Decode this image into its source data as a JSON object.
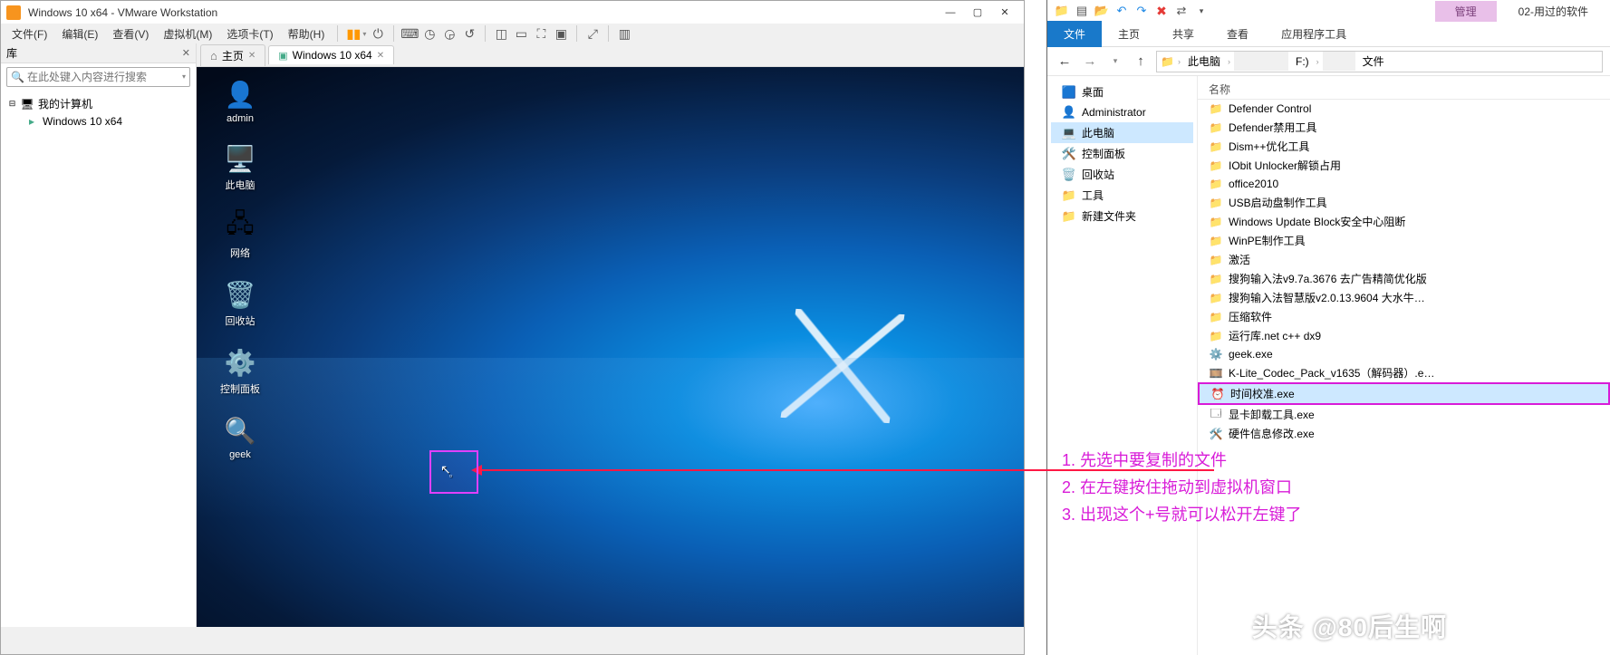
{
  "vmware": {
    "title": "Windows 10 x64 - VMware Workstation",
    "menus": [
      "文件(F)",
      "编辑(E)",
      "查看(V)",
      "虚拟机(M)",
      "选项卡(T)",
      "帮助(H)"
    ],
    "library": {
      "title": "库",
      "search_placeholder": "在此处键入内容进行搜索",
      "root": "我的计算机",
      "vm": "Windows 10 x64"
    },
    "tabs": {
      "home": "主页",
      "vm": "Windows 10 x64"
    },
    "desktop_icons": [
      {
        "name": "admin-icon",
        "label": "admin",
        "glyph": "👤",
        "bg": ""
      },
      {
        "name": "this-pc-icon",
        "label": "此电脑",
        "glyph": "🖥️"
      },
      {
        "name": "network-icon",
        "label": "网络",
        "glyph": "🖧"
      },
      {
        "name": "recycle-bin-icon",
        "label": "回收站",
        "glyph": "🗑️"
      },
      {
        "name": "control-panel-icon",
        "label": "控制面板",
        "glyph": "⚙️"
      },
      {
        "name": "geek-icon",
        "label": "geek",
        "glyph": "🔍"
      }
    ]
  },
  "explorer": {
    "context_tabs": {
      "manage": "管理",
      "folder": "02-用过的软件"
    },
    "ribbon_tabs": [
      "文件",
      "主页",
      "共享",
      "查看",
      "应用程序工具"
    ],
    "crumbs": {
      "root": "此电脑",
      "drive": "F:)",
      "folder": "文件"
    },
    "nav": [
      {
        "name": "nav-desktop",
        "label": "桌面",
        "glyph": "🟦",
        "color": "#1e88e5"
      },
      {
        "name": "nav-administrator",
        "label": "Administrator",
        "glyph": "👤"
      },
      {
        "name": "nav-this-pc",
        "label": "此电脑",
        "glyph": "💻",
        "selected": true
      },
      {
        "name": "nav-control-panel",
        "label": "控制面板",
        "glyph": "🛠️"
      },
      {
        "name": "nav-recycle",
        "label": "回收站",
        "glyph": "🗑️"
      },
      {
        "name": "nav-tools",
        "label": "工具",
        "glyph": "📁"
      },
      {
        "name": "nav-new-folder",
        "label": "新建文件夹",
        "glyph": "📁"
      }
    ],
    "columns": {
      "name": "名称"
    },
    "files": [
      {
        "name": "Defender Control",
        "type": "folder"
      },
      {
        "name": "Defender禁用工具",
        "type": "folder"
      },
      {
        "name": "Dism++优化工具",
        "type": "folder"
      },
      {
        "name": "IObit Unlocker解锁占用",
        "type": "folder"
      },
      {
        "name": "office2010",
        "type": "folder"
      },
      {
        "name": "USB启动盘制作工具",
        "type": "folder"
      },
      {
        "name": "Windows Update Block安全中心阻断",
        "type": "folder"
      },
      {
        "name": "WinPE制作工具",
        "type": "folder"
      },
      {
        "name": "激活",
        "type": "folder"
      },
      {
        "name": "搜狗输入法v9.7a.3676 去广告精简优化版",
        "type": "folder"
      },
      {
        "name": "搜狗输入法智慧版v2.0.13.9604 大水牛…",
        "type": "folder"
      },
      {
        "name": "压缩软件",
        "type": "folder"
      },
      {
        "name": "运行库.net c++ dx9",
        "type": "folder"
      },
      {
        "name": "geek.exe",
        "type": "exe",
        "glyph": "⚙️"
      },
      {
        "name": "K-Lite_Codec_Pack_v1635（解码器）.e…",
        "type": "exe",
        "glyph": "🎞️"
      },
      {
        "name": "时间校准.exe",
        "type": "exe",
        "glyph": "⏰",
        "selected": true
      },
      {
        "name": "显卡卸载工具.exe",
        "type": "exe",
        "glyph": "🗔"
      },
      {
        "name": "硬件信息修改.exe",
        "type": "exe",
        "glyph": "🛠️"
      }
    ]
  },
  "annotations": {
    "step1": "1. 先选中要复制的文件",
    "step2": "2. 在左键按住拖动到虚拟机窗口",
    "step3": "3. 出现这个+号就可以松开左键了"
  },
  "watermark": "头条 @80后生啊"
}
